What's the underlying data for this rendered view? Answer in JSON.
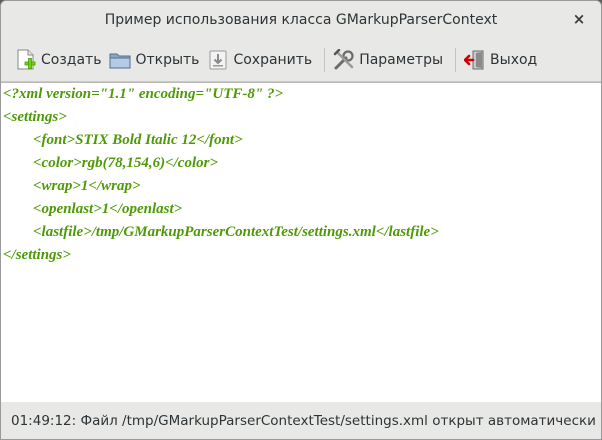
{
  "window": {
    "title": "Пример использования класса GMarkupParserContext",
    "close_glyph": "×"
  },
  "toolbar": {
    "create_label": "Создать",
    "open_label": "Открыть",
    "save_label": "Сохранить",
    "settings_label": "Параметры",
    "exit_label": "Выход"
  },
  "editor": {
    "text_color": "#4e9a06",
    "lines": [
      "<?xml version=\"1.1\" encoding=\"UTF-8\" ?>",
      "<settings>",
      "<font>STIX Bold Italic 12</font>",
      "<color>rgb(78,154,6)</color>",
      "<wrap>1</wrap>",
      "<openlast>1</openlast>",
      "<lastfile>/tmp/GMarkupParserContextTest/settings.xml</lastfile>",
      "</settings>"
    ]
  },
  "status": {
    "text": "01:49:12: Файл /tmp/GMarkupParserContextTest/settings.xml открыт автоматически"
  }
}
